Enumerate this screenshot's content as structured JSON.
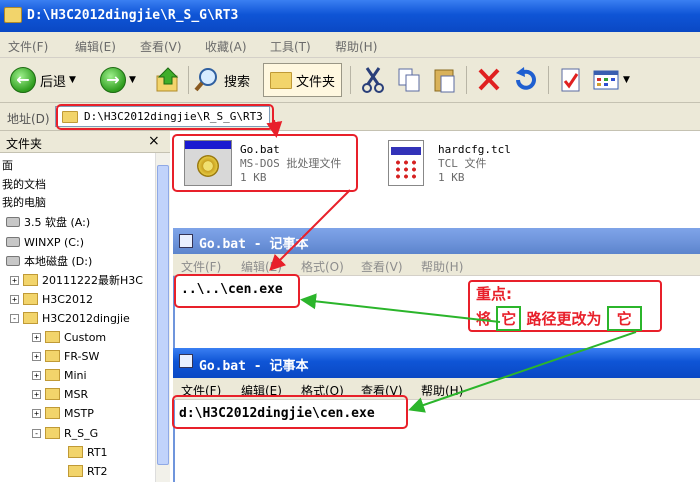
{
  "explorer": {
    "title": "D:\\H3C2012dingjie\\R_S_G\\RT3",
    "menu": [
      "文件(F)",
      "编辑(E)",
      "查看(V)",
      "收藏(A)",
      "工具(T)",
      "帮助(H)"
    ],
    "toolbar": {
      "back_label": "后退",
      "search_label": "搜索",
      "folders_label": "文件夹"
    },
    "address_label": "地址(D)",
    "address_value": "D:\\H3C2012dingjie\\R_S_G\\RT3"
  },
  "folder_pane": {
    "title": "文件夹",
    "close": "×",
    "items": [
      {
        "label": "面"
      },
      {
        "label": "我的文档"
      },
      {
        "label": "我的电脑"
      },
      {
        "label": "3.5 软盘 (A:)"
      },
      {
        "label": "WINXP (C:)"
      },
      {
        "label": "本地磁盘 (D:)"
      },
      {
        "label": "20111222最新H3C"
      },
      {
        "label": "H3C2012"
      },
      {
        "label": "H3C2012dingjie"
      },
      {
        "label": "Custom"
      },
      {
        "label": "FR-SW"
      },
      {
        "label": "Mini"
      },
      {
        "label": "MSR"
      },
      {
        "label": "MSTP"
      },
      {
        "label": "R_S_G"
      },
      {
        "label": "RT1"
      },
      {
        "label": "RT2"
      }
    ]
  },
  "files": [
    {
      "name": "Go.bat",
      "type": "MS-DOS 批处理文件",
      "size": "1 KB"
    },
    {
      "name": "hardcfg.tcl",
      "type": "TCL 文件",
      "size": "1 KB"
    }
  ],
  "notepad1": {
    "title": "Go.bat - 记事本",
    "menu": [
      "文件(F)",
      "编辑(E)",
      "格式(O)",
      "查看(V)",
      "帮助(H)"
    ],
    "content": "..\\..\\cen.exe"
  },
  "notepad2": {
    "title": "Go.bat - 记事本",
    "menu": [
      "文件(F)",
      "编辑(E)",
      "格式(O)",
      "查看(V)",
      "帮助(H)"
    ],
    "content": "d:\\H3C2012dingjie\\cen.exe"
  },
  "annotation": {
    "title": "重点:",
    "line_a": "将",
    "word1": "它",
    "line_b": "路径更改为",
    "word2": "它"
  },
  "colors": {
    "annotation_red": "#e8202a",
    "annotation_green": "#2bb52b",
    "xp_blue": "#0a48c4"
  }
}
